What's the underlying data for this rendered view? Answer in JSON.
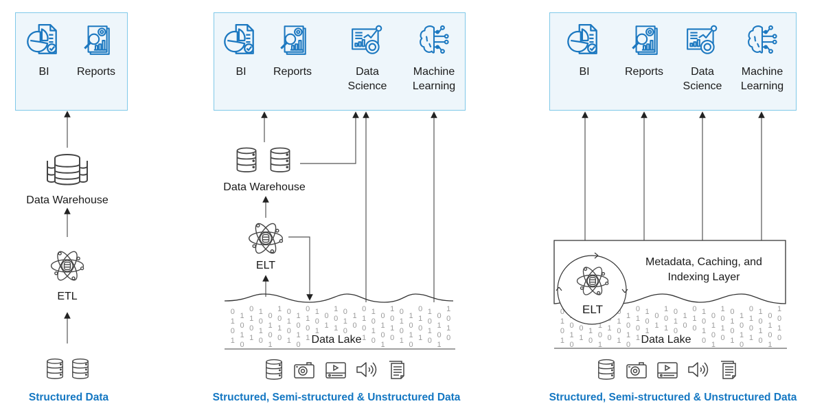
{
  "panels": [
    {
      "id": "data-warehouse",
      "consumers": [
        {
          "label": "BI",
          "icon": "bi-report-icon"
        },
        {
          "label": "Reports",
          "icon": "analytics-report-icon"
        }
      ],
      "warehouse_label": "Data Warehouse",
      "process_label": "ETL",
      "source_icons": [
        "database-icon",
        "database-icon"
      ],
      "footer": "Structured Data"
    },
    {
      "id": "data-lake",
      "consumers": [
        {
          "label": "BI",
          "icon": "bi-report-icon"
        },
        {
          "label": "Reports",
          "icon": "analytics-report-icon"
        },
        {
          "label_line1": "Data",
          "label_line2": "Science",
          "icon": "data-science-icon"
        },
        {
          "label_line1": "Machine",
          "label_line2": "Learning",
          "icon": "brain-circuit-icon"
        }
      ],
      "warehouse_label": "Data Warehouse",
      "process_label": "ELT",
      "lake_label": "Data Lake",
      "source_icons": [
        "database-icon",
        "camera-icon",
        "video-icon",
        "audio-icon",
        "document-icon"
      ],
      "footer": "Structured, Semi-structured & Unstructured Data"
    },
    {
      "id": "lakehouse",
      "consumers": [
        {
          "label": "BI",
          "icon": "bi-report-icon"
        },
        {
          "label": "Reports",
          "icon": "analytics-report-icon"
        },
        {
          "label_line1": "Data",
          "label_line2": "Science",
          "icon": "data-science-icon"
        },
        {
          "label_line1": "Machine",
          "label_line2": "Learning",
          "icon": "brain-circuit-icon"
        }
      ],
      "metadata_line1": "Metadata, Caching, and",
      "metadata_line2": "Indexing Layer",
      "process_label": "ELT",
      "lake_label": "Data Lake",
      "source_icons": [
        "database-icon",
        "camera-icon",
        "video-icon",
        "audio-icon",
        "document-icon"
      ],
      "footer": "Structured, Semi-structured & Unstructured Data"
    }
  ],
  "binary_columns": [
    "0101",
    "1010",
    "0101",
    "1010",
    "0101",
    "1010",
    "0101",
    "1010",
    "0101",
    "1010",
    "0101",
    "1010",
    "0101",
    "1010",
    "0101",
    "1010",
    "0101",
    "1010",
    "0101",
    "1010",
    "0101",
    "1010",
    "0101",
    "1010"
  ],
  "colors": {
    "accent_blue": "#1477c2",
    "icon_blue": "#1c78c0",
    "box_fill": "#eef6fb",
    "box_border": "#7fc8e8",
    "line": "#333333",
    "bits": "#9a9a9a"
  }
}
